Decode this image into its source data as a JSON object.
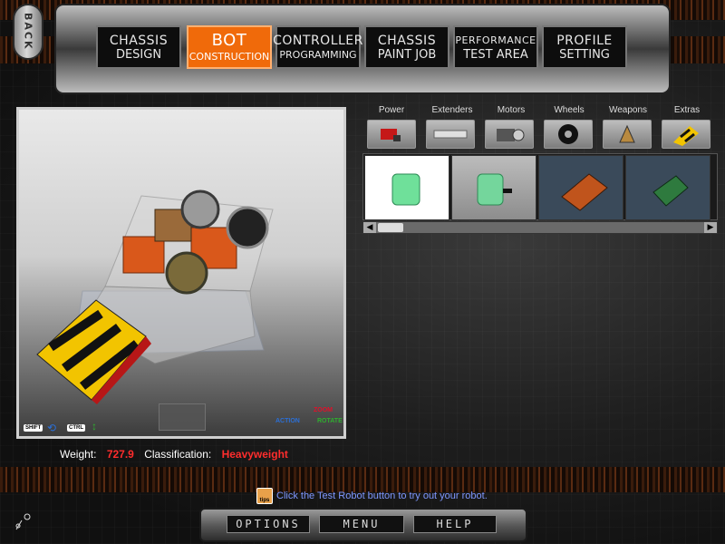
{
  "nav": {
    "back": "BACK",
    "tabs": [
      {
        "line1": "CHASSIS",
        "line2": "DESIGN"
      },
      {
        "line1": "BOT",
        "line2": "CONSTRUCTION"
      },
      {
        "line1": "CONTROLLER",
        "line2": "PROGRAMMING"
      },
      {
        "line1": "CHASSIS",
        "line2": "PAINT JOB"
      },
      {
        "line1": "PERFORMANCE",
        "line2": "TEST AREA"
      },
      {
        "line1": "PROFILE",
        "line2": "SETTING"
      }
    ],
    "active_tab": "BOT CONSTRUCTION"
  },
  "viewport": {
    "shift_key": "SHIFT",
    "ctrl_key": "CTRL",
    "action_label": "ACTION",
    "zoom_label": "ZOOM",
    "rotate_label": "ROTATE"
  },
  "parts": {
    "categories": [
      "Power",
      "Extenders",
      "Motors",
      "Wheels",
      "Weapons",
      "Extras"
    ],
    "items": [
      {
        "icon": "battery-pack-icon",
        "selected": true
      },
      {
        "icon": "battery-with-connector-icon",
        "selected": false
      },
      {
        "icon": "speed-controller-board-icon",
        "selected": false
      },
      {
        "icon": "circuit-board-icon",
        "selected": false
      }
    ]
  },
  "stats": {
    "weight_label": "Weight:",
    "weight_value": "727.9",
    "class_label": "Classification:",
    "class_value": "Heavyweight"
  },
  "tip": {
    "icon_text": "tips",
    "text": "Click the Test Robot button to try out your robot."
  },
  "bottom": {
    "options": "OPTIONS",
    "menu": "MENU",
    "help": "HELP"
  },
  "colors": {
    "accent_orange": "#f06a0a",
    "value_red": "#ff2d2d",
    "tip_blue": "#7f97ff",
    "hazard_yellow": "#f2c400"
  }
}
